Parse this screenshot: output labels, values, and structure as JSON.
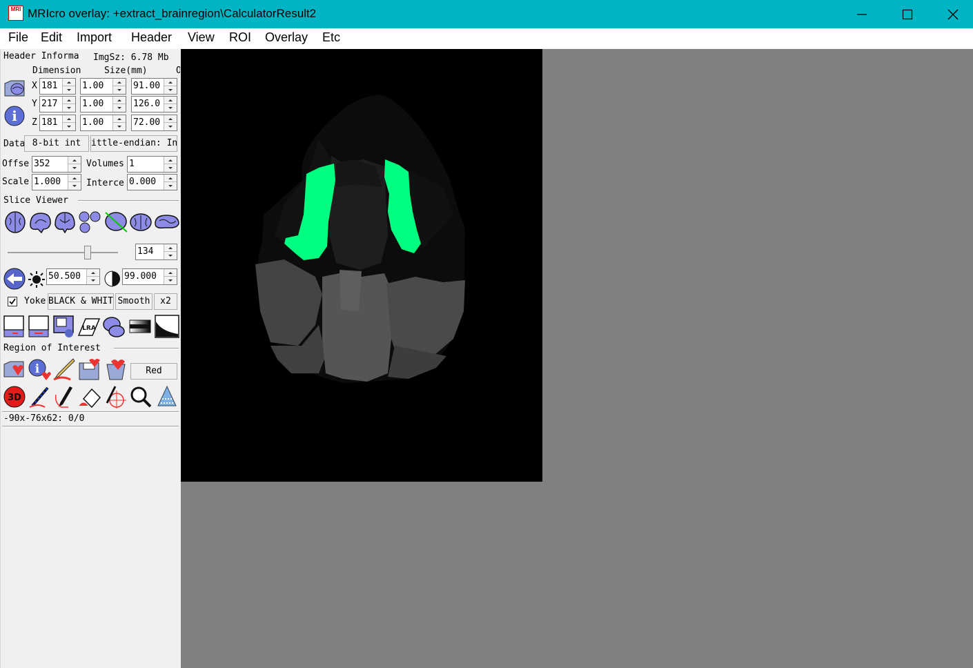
{
  "window": {
    "title": "MRIcro overlay: +extract_brainregion\\CalculatorResult2",
    "app_icon_text": "MRI"
  },
  "menu": [
    "File",
    "Edit",
    "Import",
    "Header",
    "View",
    "ROI",
    "Overlay",
    "Etc"
  ],
  "header": {
    "section_label": "Header Informa",
    "imgsz_label": "ImgSz: 6.78 Mb",
    "dimension_label": "Dimension",
    "size_label": "Size(mm)",
    "extra_label": "O",
    "axes": [
      "X",
      "Y",
      "Z"
    ],
    "dims": [
      "181",
      "217",
      "181"
    ],
    "voxel_sizes": [
      "1.00",
      "1.00",
      "1.00"
    ],
    "origins": [
      "91.00",
      "126.0",
      "72.00"
    ],
    "data_label": "Data",
    "datatype": "8-bit int",
    "endian": "ittle-endian: In",
    "offset_label": "Offse",
    "offset": "352",
    "volumes_label": "Volumes",
    "volumes": "1",
    "scale_label": "Scale",
    "scale": "1.000",
    "intercept_label": "Interce",
    "intercept": "0.000"
  },
  "slice_viewer": {
    "section_label": "Slice Viewer",
    "slice_number": "134",
    "slider_fraction": 0.74,
    "brightness": "50.500",
    "contrast": "99.000",
    "yoke_label": "Yoke",
    "yoke_checked": true,
    "colorscheme_label": "BLACK & WHITE",
    "smooth_label": "Smooth",
    "zoom_label": "x2"
  },
  "roi": {
    "section_label": "Region of Interest",
    "color_label": "Red"
  },
  "status": {
    "coords": "-90x-76x62: 0/0"
  },
  "colors": {
    "titlebar": "#00b4c4",
    "overlay_green": "#00ff80",
    "background": "#808080"
  }
}
